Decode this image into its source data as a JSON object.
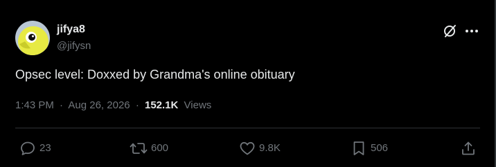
{
  "tweet": {
    "author": {
      "name": "jifya8",
      "handle": "@jifysn",
      "avatar_icon": "bird-avatar-icon"
    },
    "text": "Opsec level: Doxxed by Grandma's online obituary",
    "time": "1:43 PM",
    "date": "Aug 26, 2026",
    "separator": "·",
    "views_count": "152.1K",
    "views_label": "Views",
    "header_icons": [
      "grok-icon",
      "more-icon"
    ]
  },
  "actions": {
    "reply": {
      "icon": "reply-icon",
      "count": "23"
    },
    "retweet": {
      "icon": "retweet-icon",
      "count": "600"
    },
    "like": {
      "icon": "like-icon",
      "count": "9.8K"
    },
    "bookmark": {
      "icon": "bookmark-icon",
      "count": "506"
    },
    "share": {
      "icon": "share-icon"
    }
  },
  "colors": {
    "background": "#000000",
    "primary_text": "#e7e9ea",
    "secondary_text": "#71767b",
    "divider": "#2f3336",
    "avatar_yellow": "#e7ea43",
    "avatar_bg": "#b9c7d4"
  }
}
